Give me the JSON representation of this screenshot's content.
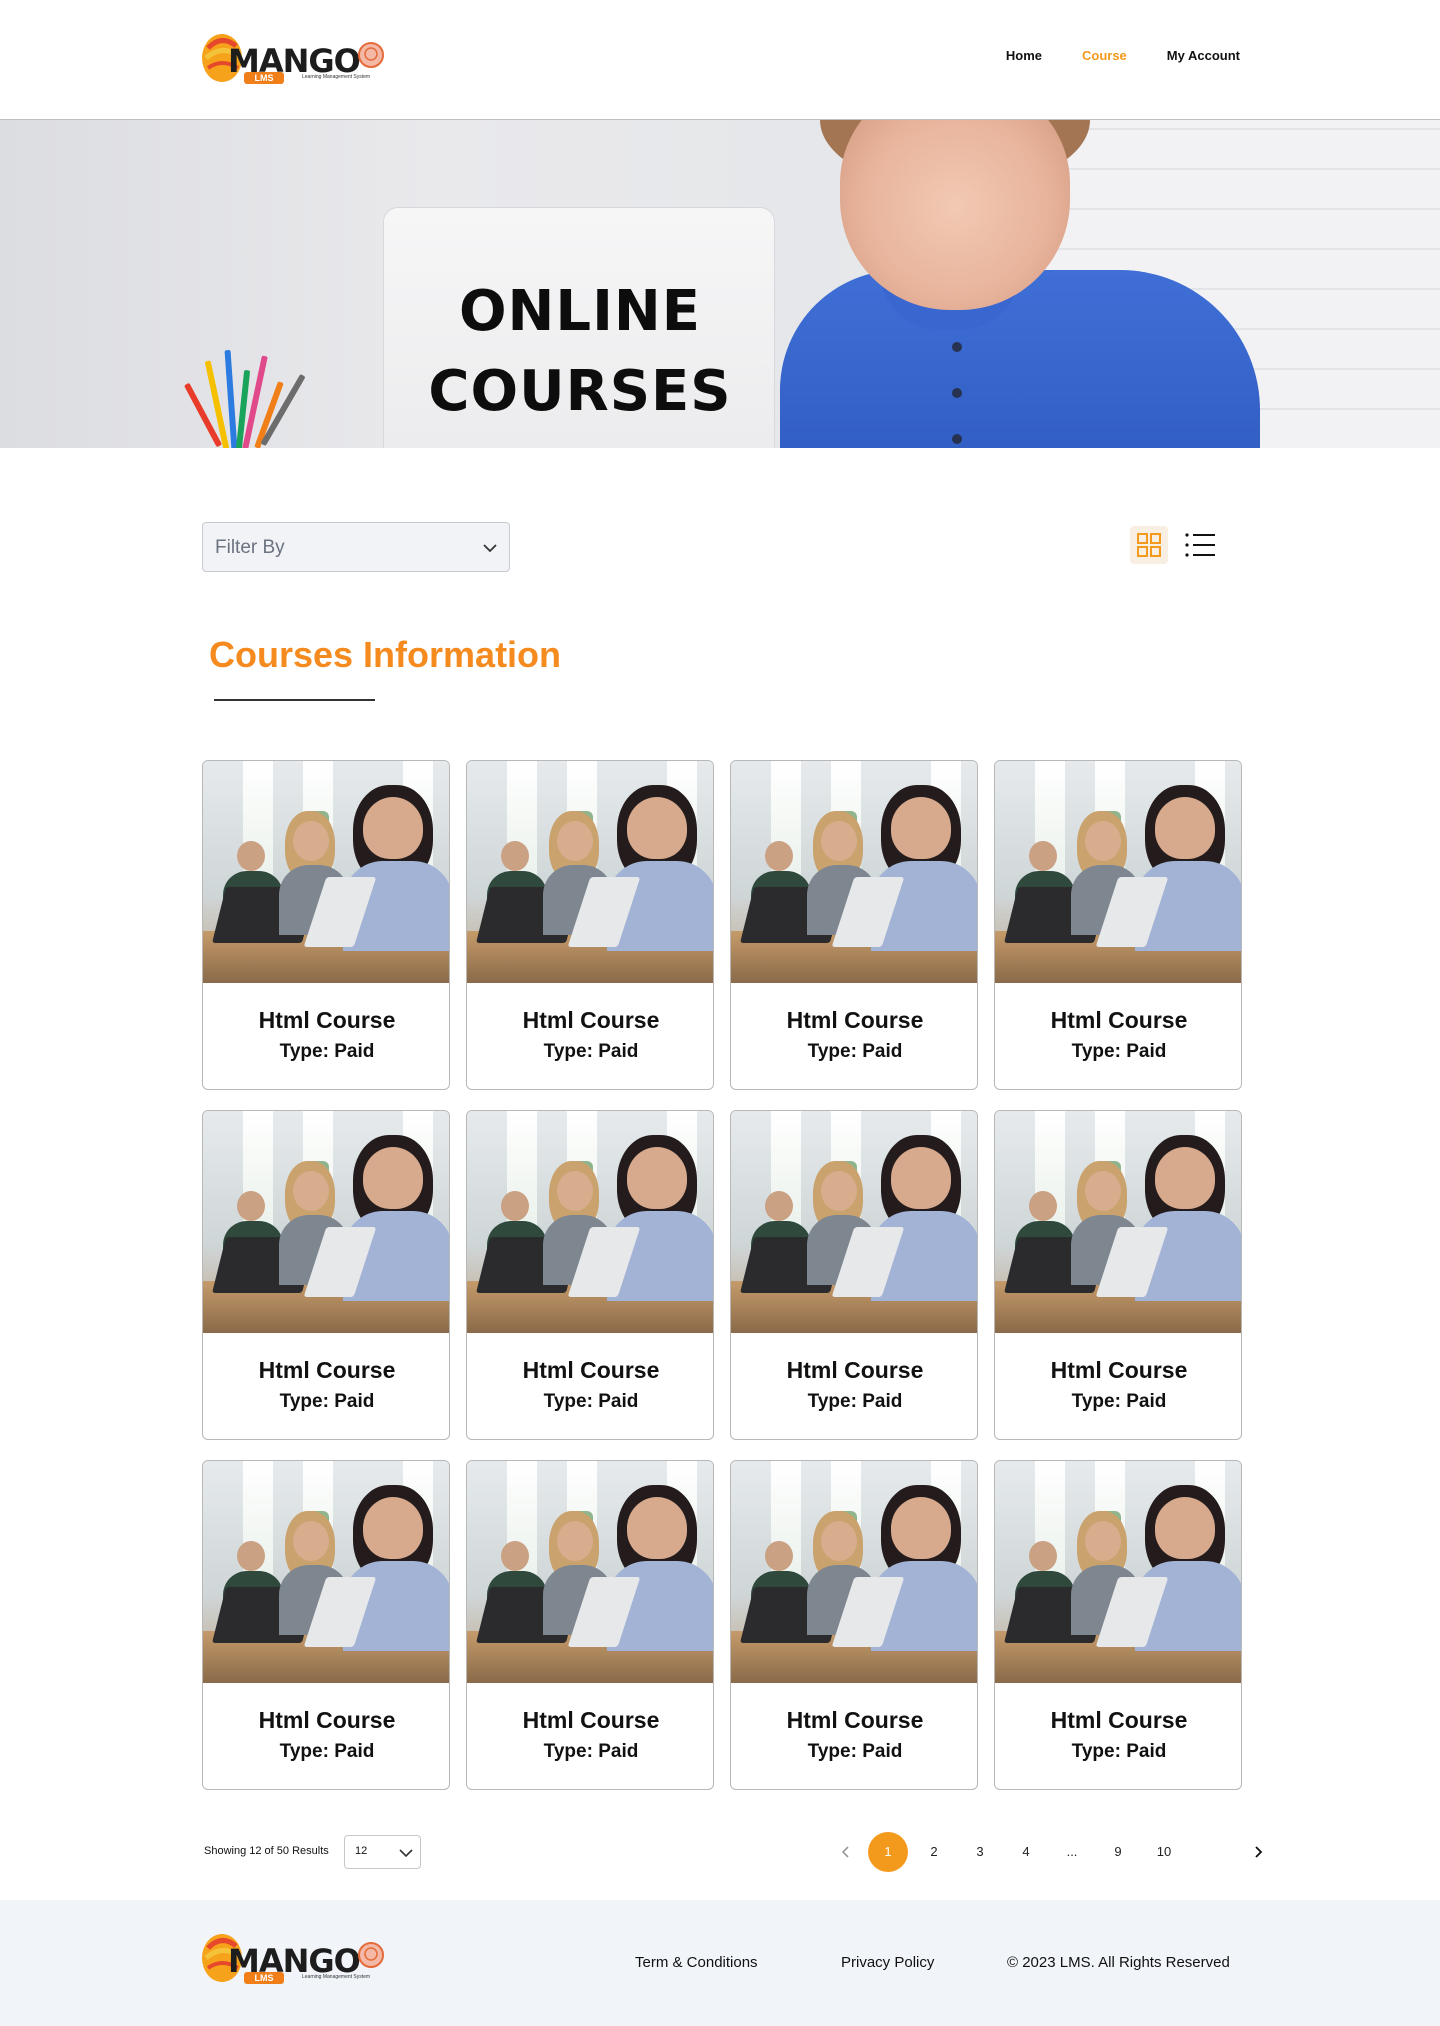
{
  "brand": {
    "name": "MANGO",
    "badge": "LMS",
    "tagline": "Learning Management System"
  },
  "nav": {
    "items": [
      {
        "label": "Home",
        "active": false
      },
      {
        "label": "Course",
        "active": true
      },
      {
        "label": "My Account",
        "active": false
      }
    ]
  },
  "hero": {
    "title_line1": "ONLINE",
    "title_line2": "COURSES"
  },
  "toolbar": {
    "filter_placeholder": "Filter By",
    "view_grid_icon": "grid-view-icon",
    "view_list_icon": "list-view-icon",
    "active_view": "grid"
  },
  "section": {
    "title": "Courses Information"
  },
  "courses": [
    {
      "title": "Html Course",
      "type": "Type: Paid"
    },
    {
      "title": "Html Course",
      "type": "Type: Paid"
    },
    {
      "title": "Html Course",
      "type": "Type: Paid"
    },
    {
      "title": "Html Course",
      "type": "Type: Paid"
    },
    {
      "title": "Html Course",
      "type": "Type: Paid"
    },
    {
      "title": "Html Course",
      "type": "Type: Paid"
    },
    {
      "title": "Html Course",
      "type": "Type: Paid"
    },
    {
      "title": "Html Course",
      "type": "Type: Paid"
    },
    {
      "title": "Html Course",
      "type": "Type: Paid"
    },
    {
      "title": "Html Course",
      "type": "Type: Paid"
    },
    {
      "title": "Html Course",
      "type": "Type: Paid"
    },
    {
      "title": "Html Course",
      "type": "Type: Paid"
    }
  ],
  "results": {
    "text": "Showing 12 of 50 Results",
    "per_page": "12"
  },
  "pagination": {
    "prev_icon": "chevron-left-icon",
    "next_icon": "chevron-right-icon",
    "pages": [
      "1",
      "2",
      "3",
      "4",
      "...",
      "9",
      "10"
    ],
    "current": "1"
  },
  "footer": {
    "terms": "Term & Conditions",
    "privacy": "Privacy Policy",
    "copyright": "© 2023 LMS. All Rights Reserved"
  },
  "colors": {
    "accent": "#f39a1c",
    "heading": "#f58a1f",
    "footer_bg": "#f1f4f9"
  }
}
